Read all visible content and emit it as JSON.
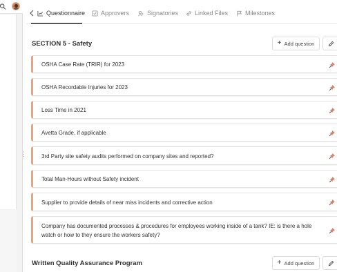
{
  "tabs": [
    {
      "label": "Questionnaire",
      "icon": "chart-icon",
      "active": true
    },
    {
      "label": "Approvers",
      "icon": "checkbox-icon",
      "active": false
    },
    {
      "label": "Signatories",
      "icon": "users-icon",
      "active": false
    },
    {
      "label": "Linked Files",
      "icon": "link-icon",
      "active": false
    },
    {
      "label": "Milestones",
      "icon": "flag-icon",
      "active": false
    }
  ],
  "sections": [
    {
      "title": "SECTION 5 - Safety",
      "add_label": "Add question"
    },
    {
      "title": "Written Quality Assurance Program",
      "add_label": "Add question"
    }
  ],
  "questions": [
    "OSHA Case Rate (TRIR) for 2023",
    "OSHA Recordable Injuries for 2023",
    "Loss Time in 2021",
    "Avetta Grade, if applicable",
    "3rd Party site safety audits performed on company sites and reported?",
    "Total Man-Hours without Safety incident",
    "Supplier to provide details of near miss incidents and corrective action",
    "Company has documented processes & procedures for employees working inside of a tank? IE: is there a hole watch or how to they ensure the workers safety?"
  ],
  "colors": {
    "accent_border": "#e8a384",
    "pin_color": "#d9826a"
  }
}
